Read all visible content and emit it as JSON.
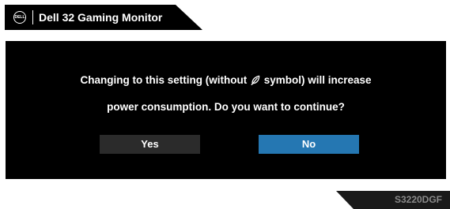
{
  "header": {
    "logo_text": "DELL",
    "title": "Dell 32 Gaming Monitor"
  },
  "dialog": {
    "message_line1_before": "Changing to this setting (without ",
    "message_line1_after": " symbol) will increase",
    "message_line2": "power consumption. Do you want to continue?",
    "symbol_icon": "leaf-icon",
    "yes_label": "Yes",
    "no_label": "No",
    "selected_button": "No"
  },
  "footer": {
    "model": "S3220DGF"
  },
  "colors": {
    "background": "#ffffff",
    "panel": "#000000",
    "text": "#ffffff",
    "button_default": "#2b2b2b",
    "button_selected": "#2577b2",
    "model_text": "#8a8a8a"
  }
}
